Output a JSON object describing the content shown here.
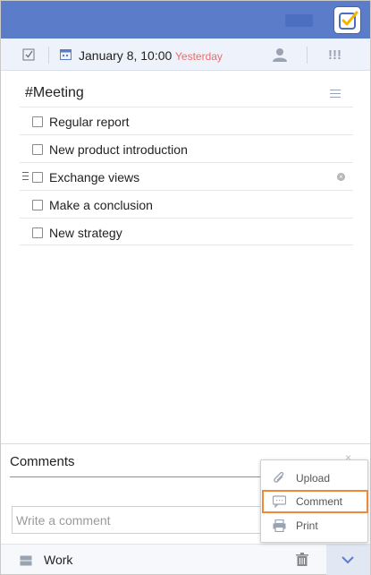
{
  "header": {
    "app_icon": "checkmark-logo-icon"
  },
  "toolbar": {
    "checkbox_icon": "checkbox-icon",
    "calendar_icon": "calendar-icon",
    "date": "January 8, 10:00",
    "relative": "Yesterday",
    "assignee_icon": "user-icon",
    "priority": "!!!"
  },
  "task": {
    "tag": "#Meeting",
    "items": [
      {
        "text": "Regular report"
      },
      {
        "text": "New product introduction"
      },
      {
        "text": "Exchange views"
      },
      {
        "text": "Make a conclusion"
      },
      {
        "text": "New strategy"
      }
    ]
  },
  "comments": {
    "title": "Comments",
    "placeholder": "Write a comment",
    "close": "×"
  },
  "footer": {
    "project": "Work"
  },
  "menu": {
    "items": [
      {
        "label": "Upload",
        "icon": "paperclip-icon"
      },
      {
        "label": "Comment",
        "icon": "comment-icon"
      },
      {
        "label": "Print",
        "icon": "printer-icon"
      }
    ]
  },
  "colors": {
    "header": "#5b7cc8",
    "highlight": "#f0883a",
    "relative_date": "#ee6b6b"
  }
}
